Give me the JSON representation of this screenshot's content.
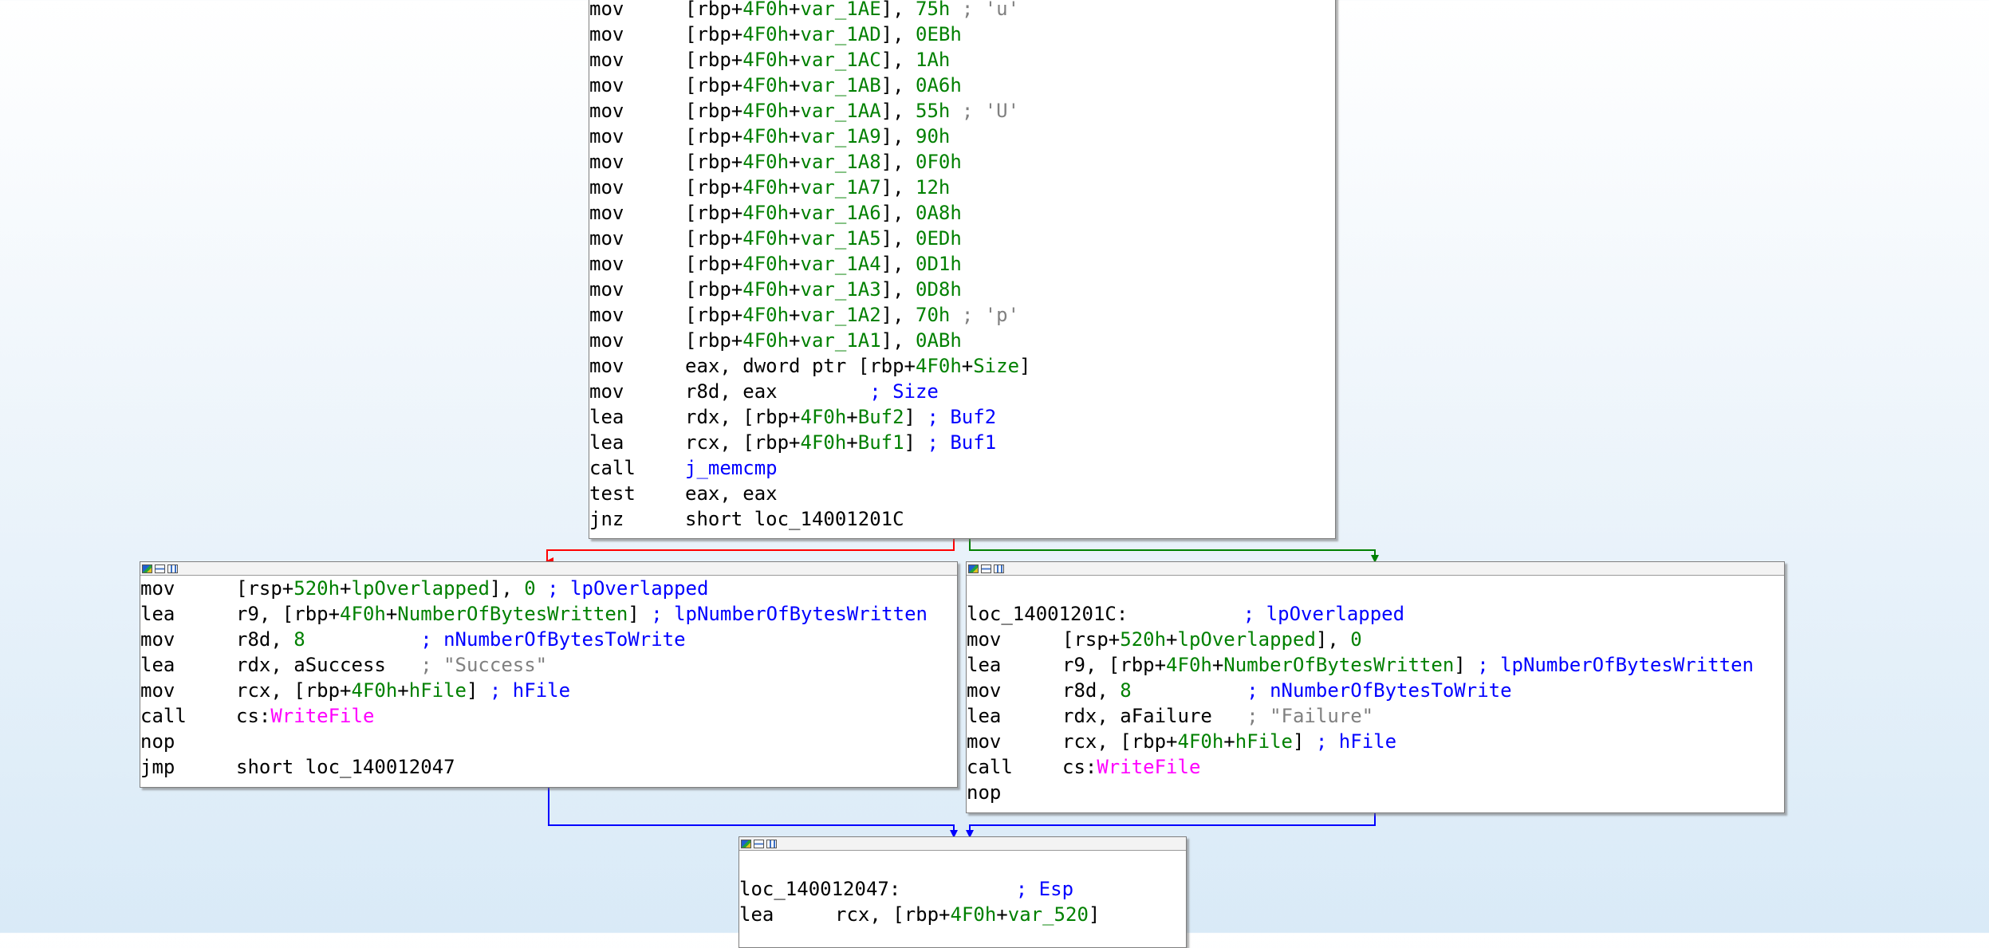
{
  "colors": {
    "mnemonic": "#000000",
    "register": "#000000",
    "number": "#008000",
    "operand_name": "#0000ff",
    "comment": "#808080",
    "import": "#ff00ff",
    "edge_true": "#ff0000",
    "edge_false": "#008000",
    "edge_flow": "#0000ff"
  },
  "blocks": [
    {
      "id": "top",
      "has_titlebar": false,
      "lines": [
        {
          "mn": "mov",
          "ops": [
            {
              "t": "[rbp+",
              "c": "reg"
            },
            {
              "t": "4F0h",
              "c": "num"
            },
            {
              "t": "+",
              "c": "reg"
            },
            {
              "t": "var_1AE",
              "c": "num"
            },
            {
              "t": "], ",
              "c": "reg"
            },
            {
              "t": "75h",
              "c": "num"
            },
            {
              "t": " ; 'u'",
              "c": "cm"
            }
          ]
        },
        {
          "mn": "mov",
          "ops": [
            {
              "t": "[rbp+",
              "c": "reg"
            },
            {
              "t": "4F0h",
              "c": "num"
            },
            {
              "t": "+",
              "c": "reg"
            },
            {
              "t": "var_1AD",
              "c": "num"
            },
            {
              "t": "], ",
              "c": "reg"
            },
            {
              "t": "0EBh",
              "c": "num"
            }
          ]
        },
        {
          "mn": "mov",
          "ops": [
            {
              "t": "[rbp+",
              "c": "reg"
            },
            {
              "t": "4F0h",
              "c": "num"
            },
            {
              "t": "+",
              "c": "reg"
            },
            {
              "t": "var_1AC",
              "c": "num"
            },
            {
              "t": "], ",
              "c": "reg"
            },
            {
              "t": "1Ah",
              "c": "num"
            }
          ]
        },
        {
          "mn": "mov",
          "ops": [
            {
              "t": "[rbp+",
              "c": "reg"
            },
            {
              "t": "4F0h",
              "c": "num"
            },
            {
              "t": "+",
              "c": "reg"
            },
            {
              "t": "var_1AB",
              "c": "num"
            },
            {
              "t": "], ",
              "c": "reg"
            },
            {
              "t": "0A6h",
              "c": "num"
            }
          ]
        },
        {
          "mn": "mov",
          "ops": [
            {
              "t": "[rbp+",
              "c": "reg"
            },
            {
              "t": "4F0h",
              "c": "num"
            },
            {
              "t": "+",
              "c": "reg"
            },
            {
              "t": "var_1AA",
              "c": "num"
            },
            {
              "t": "], ",
              "c": "reg"
            },
            {
              "t": "55h",
              "c": "num"
            },
            {
              "t": " ; 'U'",
              "c": "cm"
            }
          ]
        },
        {
          "mn": "mov",
          "ops": [
            {
              "t": "[rbp+",
              "c": "reg"
            },
            {
              "t": "4F0h",
              "c": "num"
            },
            {
              "t": "+",
              "c": "reg"
            },
            {
              "t": "var_1A9",
              "c": "num"
            },
            {
              "t": "], ",
              "c": "reg"
            },
            {
              "t": "90h",
              "c": "num"
            }
          ]
        },
        {
          "mn": "mov",
          "ops": [
            {
              "t": "[rbp+",
              "c": "reg"
            },
            {
              "t": "4F0h",
              "c": "num"
            },
            {
              "t": "+",
              "c": "reg"
            },
            {
              "t": "var_1A8",
              "c": "num"
            },
            {
              "t": "], ",
              "c": "reg"
            },
            {
              "t": "0F0h",
              "c": "num"
            }
          ]
        },
        {
          "mn": "mov",
          "ops": [
            {
              "t": "[rbp+",
              "c": "reg"
            },
            {
              "t": "4F0h",
              "c": "num"
            },
            {
              "t": "+",
              "c": "reg"
            },
            {
              "t": "var_1A7",
              "c": "num"
            },
            {
              "t": "], ",
              "c": "reg"
            },
            {
              "t": "12h",
              "c": "num"
            }
          ]
        },
        {
          "mn": "mov",
          "ops": [
            {
              "t": "[rbp+",
              "c": "reg"
            },
            {
              "t": "4F0h",
              "c": "num"
            },
            {
              "t": "+",
              "c": "reg"
            },
            {
              "t": "var_1A6",
              "c": "num"
            },
            {
              "t": "], ",
              "c": "reg"
            },
            {
              "t": "0A8h",
              "c": "num"
            }
          ]
        },
        {
          "mn": "mov",
          "ops": [
            {
              "t": "[rbp+",
              "c": "reg"
            },
            {
              "t": "4F0h",
              "c": "num"
            },
            {
              "t": "+",
              "c": "reg"
            },
            {
              "t": "var_1A5",
              "c": "num"
            },
            {
              "t": "], ",
              "c": "reg"
            },
            {
              "t": "0EDh",
              "c": "num"
            }
          ]
        },
        {
          "mn": "mov",
          "ops": [
            {
              "t": "[rbp+",
              "c": "reg"
            },
            {
              "t": "4F0h",
              "c": "num"
            },
            {
              "t": "+",
              "c": "reg"
            },
            {
              "t": "var_1A4",
              "c": "num"
            },
            {
              "t": "], ",
              "c": "reg"
            },
            {
              "t": "0D1h",
              "c": "num"
            }
          ]
        },
        {
          "mn": "mov",
          "ops": [
            {
              "t": "[rbp+",
              "c": "reg"
            },
            {
              "t": "4F0h",
              "c": "num"
            },
            {
              "t": "+",
              "c": "reg"
            },
            {
              "t": "var_1A3",
              "c": "num"
            },
            {
              "t": "], ",
              "c": "reg"
            },
            {
              "t": "0D8h",
              "c": "num"
            }
          ]
        },
        {
          "mn": "mov",
          "ops": [
            {
              "t": "[rbp+",
              "c": "reg"
            },
            {
              "t": "4F0h",
              "c": "num"
            },
            {
              "t": "+",
              "c": "reg"
            },
            {
              "t": "var_1A2",
              "c": "num"
            },
            {
              "t": "], ",
              "c": "reg"
            },
            {
              "t": "70h",
              "c": "num"
            },
            {
              "t": " ; 'p'",
              "c": "cm"
            }
          ]
        },
        {
          "mn": "mov",
          "ops": [
            {
              "t": "[rbp+",
              "c": "reg"
            },
            {
              "t": "4F0h",
              "c": "num"
            },
            {
              "t": "+",
              "c": "reg"
            },
            {
              "t": "var_1A1",
              "c": "num"
            },
            {
              "t": "], ",
              "c": "reg"
            },
            {
              "t": "0ABh",
              "c": "num"
            }
          ]
        },
        {
          "mn": "mov",
          "ops": [
            {
              "t": "eax, dword ptr [rbp+",
              "c": "reg"
            },
            {
              "t": "4F0h",
              "c": "num"
            },
            {
              "t": "+",
              "c": "reg"
            },
            {
              "t": "Size",
              "c": "num"
            },
            {
              "t": "]",
              "c": "reg"
            }
          ]
        },
        {
          "mn": "mov",
          "ops": [
            {
              "t": "r8d, eax        ",
              "c": "reg"
            },
            {
              "t": "; Size",
              "c": "op"
            }
          ]
        },
        {
          "mn": "lea",
          "ops": [
            {
              "t": "rdx, [rbp+",
              "c": "reg"
            },
            {
              "t": "4F0h",
              "c": "num"
            },
            {
              "t": "+",
              "c": "reg"
            },
            {
              "t": "Buf2",
              "c": "num"
            },
            {
              "t": "] ",
              "c": "reg"
            },
            {
              "t": "; Buf2",
              "c": "op"
            }
          ]
        },
        {
          "mn": "lea",
          "ops": [
            {
              "t": "rcx, [rbp+",
              "c": "reg"
            },
            {
              "t": "4F0h",
              "c": "num"
            },
            {
              "t": "+",
              "c": "reg"
            },
            {
              "t": "Buf1",
              "c": "num"
            },
            {
              "t": "] ",
              "c": "reg"
            },
            {
              "t": "; Buf1",
              "c": "op"
            }
          ]
        },
        {
          "mn": "call",
          "ops": [
            {
              "t": "j_memcmp",
              "c": "op"
            }
          ]
        },
        {
          "mn": "test",
          "ops": [
            {
              "t": "eax, eax",
              "c": "reg"
            }
          ]
        },
        {
          "mn": "jnz",
          "ops": [
            {
              "t": "short loc_14001201C",
              "c": "reg"
            }
          ]
        }
      ]
    },
    {
      "id": "success",
      "has_titlebar": true,
      "lines": [
        {
          "mn": "mov",
          "ops": [
            {
              "t": "[rsp+",
              "c": "reg"
            },
            {
              "t": "520h",
              "c": "num"
            },
            {
              "t": "+",
              "c": "reg"
            },
            {
              "t": "lpOverlapped",
              "c": "num"
            },
            {
              "t": "], ",
              "c": "reg"
            },
            {
              "t": "0",
              "c": "num"
            },
            {
              "t": " ",
              "c": "reg"
            },
            {
              "t": "; lpOverlapped",
              "c": "op"
            }
          ]
        },
        {
          "mn": "lea",
          "ops": [
            {
              "t": "r9, [rbp+",
              "c": "reg"
            },
            {
              "t": "4F0h",
              "c": "num"
            },
            {
              "t": "+",
              "c": "reg"
            },
            {
              "t": "NumberOfBytesWritten",
              "c": "num"
            },
            {
              "t": "] ",
              "c": "reg"
            },
            {
              "t": "; lpNumberOfBytesWritten",
              "c": "op"
            }
          ]
        },
        {
          "mn": "mov",
          "ops": [
            {
              "t": "r8d, ",
              "c": "reg"
            },
            {
              "t": "8",
              "c": "num"
            },
            {
              "t": "          ",
              "c": "reg"
            },
            {
              "t": "; nNumberOfBytesToWrite",
              "c": "op"
            }
          ]
        },
        {
          "mn": "lea",
          "ops": [
            {
              "t": "rdx, aSuccess   ",
              "c": "reg"
            },
            {
              "t": "; \"Success\"",
              "c": "cm"
            }
          ]
        },
        {
          "mn": "mov",
          "ops": [
            {
              "t": "rcx, [rbp+",
              "c": "reg"
            },
            {
              "t": "4F0h",
              "c": "num"
            },
            {
              "t": "+",
              "c": "reg"
            },
            {
              "t": "hFile",
              "c": "num"
            },
            {
              "t": "] ",
              "c": "reg"
            },
            {
              "t": "; hFile",
              "c": "op"
            }
          ]
        },
        {
          "mn": "call",
          "ops": [
            {
              "t": "cs:",
              "c": "reg"
            },
            {
              "t": "WriteFile",
              "c": "im"
            }
          ]
        },
        {
          "mn": "nop",
          "ops": []
        },
        {
          "mn": "jmp",
          "ops": [
            {
              "t": "short loc_140012047",
              "c": "reg"
            }
          ]
        }
      ]
    },
    {
      "id": "failure",
      "has_titlebar": true,
      "lines": [
        {
          "mn": "",
          "ops": []
        },
        {
          "mn": "",
          "ops": [
            {
              "t": "loc_14001201C:          ",
              "c": "reg"
            },
            {
              "t": "; lpOverlapped",
              "c": "op"
            }
          ],
          "label_line": true
        },
        {
          "mn": "mov",
          "ops": [
            {
              "t": "[rsp+",
              "c": "reg"
            },
            {
              "t": "520h",
              "c": "num"
            },
            {
              "t": "+",
              "c": "reg"
            },
            {
              "t": "lpOverlapped",
              "c": "num"
            },
            {
              "t": "], ",
              "c": "reg"
            },
            {
              "t": "0",
              "c": "num"
            }
          ]
        },
        {
          "mn": "lea",
          "ops": [
            {
              "t": "r9, [rbp+",
              "c": "reg"
            },
            {
              "t": "4F0h",
              "c": "num"
            },
            {
              "t": "+",
              "c": "reg"
            },
            {
              "t": "NumberOfBytesWritten",
              "c": "num"
            },
            {
              "t": "] ",
              "c": "reg"
            },
            {
              "t": "; lpNumberOfBytesWritten",
              "c": "op"
            }
          ]
        },
        {
          "mn": "mov",
          "ops": [
            {
              "t": "r8d, ",
              "c": "reg"
            },
            {
              "t": "8",
              "c": "num"
            },
            {
              "t": "          ",
              "c": "reg"
            },
            {
              "t": "; nNumberOfBytesToWrite",
              "c": "op"
            }
          ]
        },
        {
          "mn": "lea",
          "ops": [
            {
              "t": "rdx, aFailure   ",
              "c": "reg"
            },
            {
              "t": "; \"Failure\"",
              "c": "cm"
            }
          ]
        },
        {
          "mn": "mov",
          "ops": [
            {
              "t": "rcx, [rbp+",
              "c": "reg"
            },
            {
              "t": "4F0h",
              "c": "num"
            },
            {
              "t": "+",
              "c": "reg"
            },
            {
              "t": "hFile",
              "c": "num"
            },
            {
              "t": "] ",
              "c": "reg"
            },
            {
              "t": "; hFile",
              "c": "op"
            }
          ]
        },
        {
          "mn": "call",
          "ops": [
            {
              "t": "cs:",
              "c": "reg"
            },
            {
              "t": "WriteFile",
              "c": "im"
            }
          ]
        },
        {
          "mn": "nop",
          "ops": []
        }
      ]
    },
    {
      "id": "end",
      "has_titlebar": true,
      "lines": [
        {
          "mn": "",
          "ops": []
        },
        {
          "mn": "",
          "ops": [
            {
              "t": "loc_140012047:          ",
              "c": "reg"
            },
            {
              "t": "; Esp",
              "c": "op"
            }
          ],
          "label_line": true
        },
        {
          "mn": "lea",
          "ops": [
            {
              "t": "rcx, [rbp+",
              "c": "reg"
            },
            {
              "t": "4F0h",
              "c": "num"
            },
            {
              "t": "+",
              "c": "reg"
            },
            {
              "t": "var_520",
              "c": "num"
            },
            {
              "t": "]",
              "c": "reg"
            }
          ]
        }
      ]
    }
  ],
  "icons": [
    "color-icon",
    "graph-icon",
    "nodes-icon"
  ]
}
